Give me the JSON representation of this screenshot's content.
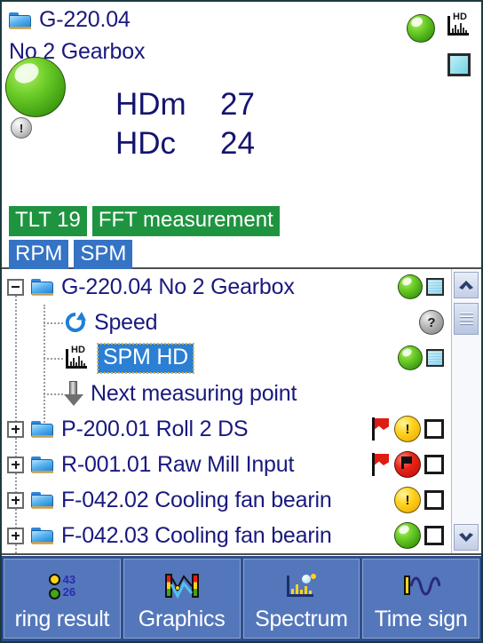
{
  "header": {
    "folder_icon": "folder-icon",
    "title_line1": "G-220.04",
    "title_line2": "No 2 Gearbox",
    "readouts": [
      {
        "label": "HDm",
        "value": "27"
      },
      {
        "label": "HDc",
        "value": "24"
      }
    ],
    "left_icons": [
      "flag-badge-icon",
      "exclamation-badge-icon",
      "green-led-icon"
    ],
    "right_icons": [
      "green-led-icon",
      "hd-spectrum-icon",
      "cyan-square-icon"
    ],
    "badges": [
      {
        "text": "TLT 19",
        "color": "#1f9440",
        "style": "green"
      },
      {
        "text": "FFT measurement",
        "color": "#1f9440",
        "style": "green"
      },
      {
        "text": "RPM",
        "color": "#3573c4",
        "style": "blue"
      },
      {
        "text": "SPM",
        "color": "#3573c4",
        "style": "blue"
      }
    ]
  },
  "tree": {
    "rows": [
      {
        "expander": "minus",
        "icon": "folder-icon",
        "label": "G-220.04 No 2 Gearbox",
        "selected": false,
        "status": "green-led",
        "extra": "cyan-square"
      },
      {
        "expander": "none",
        "icon": "speed-refresh-icon",
        "label": "Speed",
        "selected": false,
        "status": "gray-question-led",
        "extra": "none"
      },
      {
        "expander": "none",
        "icon": "hd-spectrum-icon",
        "label": "SPM HD",
        "selected": true,
        "status": "green-led",
        "extra": "cyan-square"
      },
      {
        "expander": "none",
        "icon": "down-arrow-icon",
        "label": "Next measuring point",
        "selected": false,
        "status": "none",
        "extra": "none"
      },
      {
        "expander": "plus",
        "icon": "folder-icon",
        "label": "P-200.01 Roll 2 DS",
        "selected": false,
        "status": "yellow-warning-led",
        "extra": "checkbox",
        "flag": "red-flag"
      },
      {
        "expander": "plus",
        "icon": "folder-icon",
        "label": "R-001.01 Raw Mill Input",
        "selected": false,
        "status": "red-alarm-led",
        "extra": "checkbox",
        "flag": "red-flag"
      },
      {
        "expander": "plus",
        "icon": "folder-icon",
        "label": "F-042.02 Cooling fan bearin",
        "selected": false,
        "status": "yellow-warning-led",
        "extra": "checkbox"
      },
      {
        "expander": "plus",
        "icon": "folder-icon",
        "label": "F-042.03 Cooling fan bearin",
        "selected": false,
        "status": "green-led",
        "extra": "checkbox"
      }
    ],
    "scrollbar": {
      "up_icon": "chevron-up-icon",
      "down_icon": "chevron-down-icon",
      "thumb_icon": "scroll-thumb-grip"
    }
  },
  "toolbar": {
    "buttons": [
      {
        "label": "ring result",
        "icon": "measuring-result-icon",
        "icon_numbers": [
          "43",
          "26"
        ]
      },
      {
        "label": "Graphics",
        "icon": "graphics-icon"
      },
      {
        "label": "Spectrum",
        "icon": "spectrum-icon"
      },
      {
        "label": "Time sign",
        "icon": "time-signal-icon"
      }
    ]
  },
  "colors": {
    "text_navy": "#19197e",
    "badge_green": "#1f9440",
    "badge_blue": "#3573c4",
    "toolbar_bg": "#2d4f8e",
    "toolbar_button": "#5477bb",
    "selection_blue": "#2b7fd4",
    "led_green": "#4fb51a",
    "led_yellow": "#ffd21e",
    "led_red": "#e8261a",
    "led_gray": "#b9b9b9"
  }
}
